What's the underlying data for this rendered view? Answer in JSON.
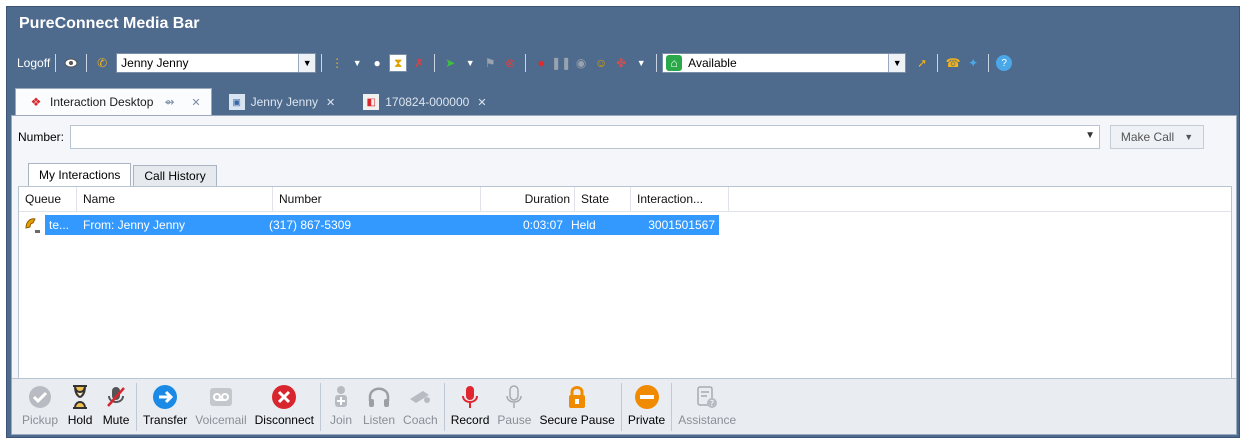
{
  "app": {
    "title": "PureConnect Media Bar"
  },
  "toolbar": {
    "logoff_label": "Logoff",
    "user_select_value": "Jenny Jenny",
    "status_select_value": "Available"
  },
  "tabs": [
    {
      "label": "Interaction Desktop",
      "icon": "interaction-desktop-icon"
    },
    {
      "label": "Jenny Jenny",
      "icon": "user-card-icon"
    },
    {
      "label": "170824-000000",
      "icon": "document-icon"
    }
  ],
  "number": {
    "label": "Number:",
    "value": "",
    "make_call_label": "Make Call"
  },
  "subtabs": [
    "My Interactions",
    "Call History"
  ],
  "grid": {
    "columns": [
      "Queue",
      "Name",
      "Number",
      "Duration",
      "State",
      "Interaction..."
    ],
    "rows": [
      {
        "queue": "te...",
        "name": "From: Jenny Jenny",
        "number": "(317) 867-5309",
        "duration": "0:03:07",
        "state": "Held",
        "interaction": "3001501567"
      }
    ]
  },
  "actions": [
    {
      "label": "Pickup",
      "enabled": false,
      "icon": "check-icon"
    },
    {
      "label": "Hold",
      "enabled": true,
      "icon": "hourglass-icon"
    },
    {
      "label": "Mute",
      "enabled": true,
      "icon": "mute-mic-icon"
    },
    {
      "label": "Transfer",
      "enabled": true,
      "icon": "transfer-arrow-icon"
    },
    {
      "label": "Voicemail",
      "enabled": false,
      "icon": "voicemail-icon"
    },
    {
      "label": "Disconnect",
      "enabled": true,
      "icon": "disconnect-icon"
    },
    {
      "label": "Join",
      "enabled": false,
      "icon": "join-icon"
    },
    {
      "label": "Listen",
      "enabled": false,
      "icon": "headset-icon"
    },
    {
      "label": "Coach",
      "enabled": false,
      "icon": "coach-icon"
    },
    {
      "label": "Record",
      "enabled": true,
      "icon": "record-mic-icon"
    },
    {
      "label": "Pause",
      "enabled": false,
      "icon": "pause-mic-icon"
    },
    {
      "label": "Secure Pause",
      "enabled": true,
      "icon": "lock-icon"
    },
    {
      "label": "Private",
      "enabled": true,
      "icon": "private-icon"
    },
    {
      "label": "Assistance",
      "enabled": false,
      "icon": "assistance-icon"
    }
  ],
  "colors": {
    "window_bg": "#4e6a8c",
    "selection": "#3399ff",
    "transfer_blue": "#1a8ae6",
    "disconnect_red": "#d9262e",
    "record_red": "#e0262e",
    "secure_orange": "#f08a00"
  }
}
